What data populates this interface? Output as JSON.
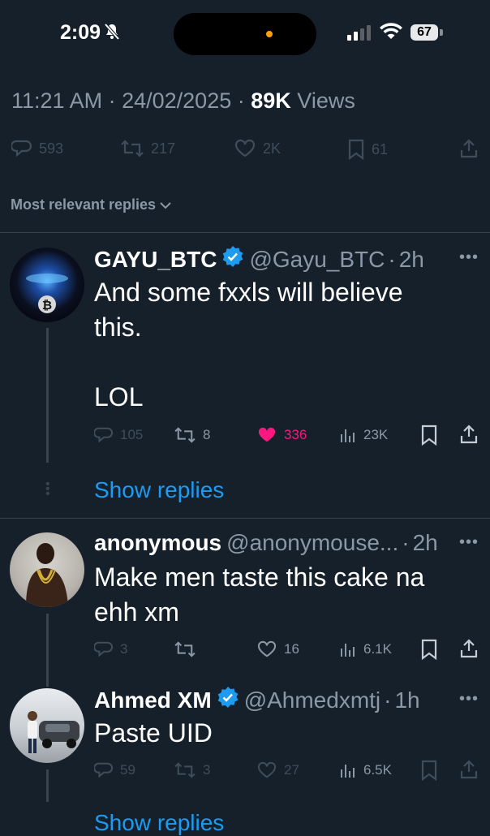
{
  "status_bar": {
    "time": "2:09",
    "battery": "67"
  },
  "tweet_meta": {
    "time": "11:21 AM",
    "date": "24/02/2025",
    "views_count": "89K",
    "views_label": "Views"
  },
  "tweet_actions": {
    "replies": "593",
    "reposts": "217",
    "likes": "2K",
    "bookmarks": "61"
  },
  "sort": {
    "label": "Most relevant replies"
  },
  "replies": [
    {
      "name": "GAYU_BTC",
      "handle": "@Gayu_BTC",
      "time": "2h",
      "verified": true,
      "text": "And some fxxls will believe\nthis.\n\nLOL",
      "replies": "105",
      "reposts": "8",
      "likes": "336",
      "views": "23K",
      "liked": true,
      "show_replies": "Show replies"
    },
    {
      "name": "anonymous",
      "handle": "@anonymouse...",
      "time": "2h",
      "verified": false,
      "text": "Make men taste this cake na\nehh xm",
      "replies": "3",
      "reposts": "",
      "likes": "16",
      "views": "6.1K",
      "liked": false
    },
    {
      "name": "Ahmed XM",
      "handle": "@Ahmedxmtj",
      "time": "1h",
      "verified": true,
      "text": "Paste UID",
      "replies": "59",
      "reposts": "3",
      "likes": "27",
      "views": "6.5K",
      "liked": false,
      "show_replies": "Show replies"
    }
  ],
  "colors": {
    "background": "#15202b",
    "accent": "#1d9bf0",
    "like": "#f91880",
    "muted": "#8b98a5"
  }
}
